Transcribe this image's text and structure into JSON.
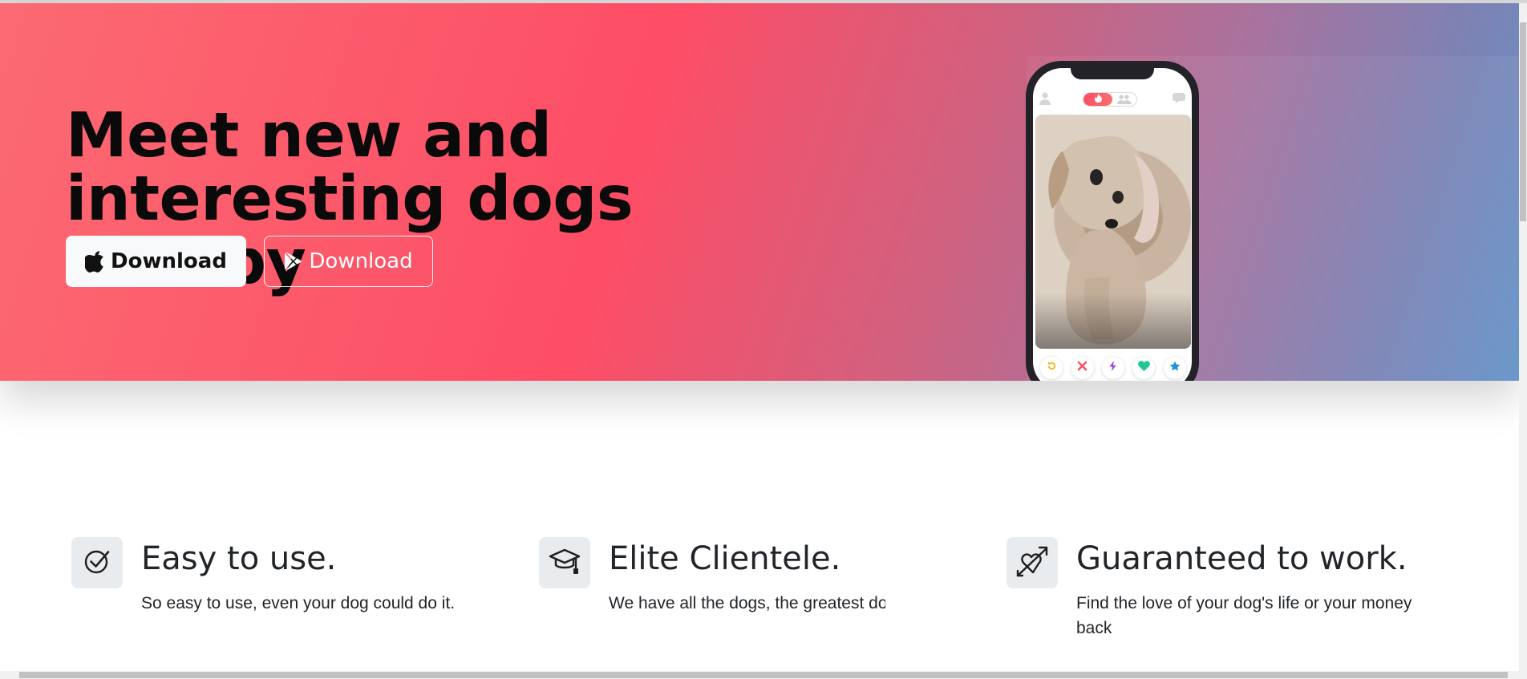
{
  "hero": {
    "title": "Meet new and interesting dogs nearby",
    "app_store_button": "Download",
    "play_store_button": "Download",
    "colors": {
      "gradient_start": "#fb6a72",
      "gradient_mid": "#fd4d66",
      "gradient_end": "#6493c9"
    }
  },
  "phone": {
    "top_nav": [
      "user-icon",
      "flame-toggle",
      "chat-icon"
    ],
    "card_photo": "dog-photo",
    "actions": [
      "rewind-icon",
      "x-icon",
      "boost-icon",
      "heart-icon",
      "star-icon"
    ]
  },
  "features": [
    {
      "icon": "check-circle-icon",
      "title": "Easy to use.",
      "text": "So easy to use, even your dog could do it."
    },
    {
      "icon": "graduation-cap-icon",
      "title": "Elite Clientele.",
      "text": "We have all the dogs, the greatest dogs."
    },
    {
      "icon": "heart-arrow-icon",
      "title": "Guaranteed to work.",
      "text": "Find the love of your dog's life or your money back"
    }
  ]
}
